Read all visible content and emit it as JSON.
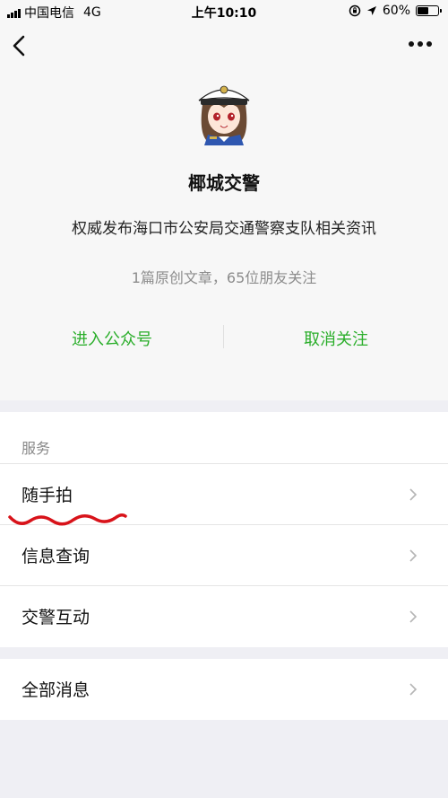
{
  "status_bar": {
    "carrier": "中国电信",
    "network": "4G",
    "time": "上午10:10",
    "battery": "60%",
    "battery_level": 0.6
  },
  "nav": {
    "back_icon": "chevron-left-icon",
    "more_icon": "more-dots-icon"
  },
  "account": {
    "avatar_icon": "police-officer-avatar",
    "name": "椰城交警",
    "description": "权威发布海口市公安局交通警察支队相关资讯",
    "stats": "1篇原创文章，65位朋友关注"
  },
  "actions": {
    "enter": "进入公众号",
    "unfollow": "取消关注"
  },
  "services": {
    "header": "服务",
    "items": [
      {
        "label": "随手拍"
      },
      {
        "label": "信息查询"
      },
      {
        "label": "交警互动"
      }
    ]
  },
  "messages": {
    "label": "全部消息"
  },
  "colors": {
    "accent_green": "#2aae2a",
    "annotation_red": "#d8131a",
    "background": "#efeff4"
  }
}
